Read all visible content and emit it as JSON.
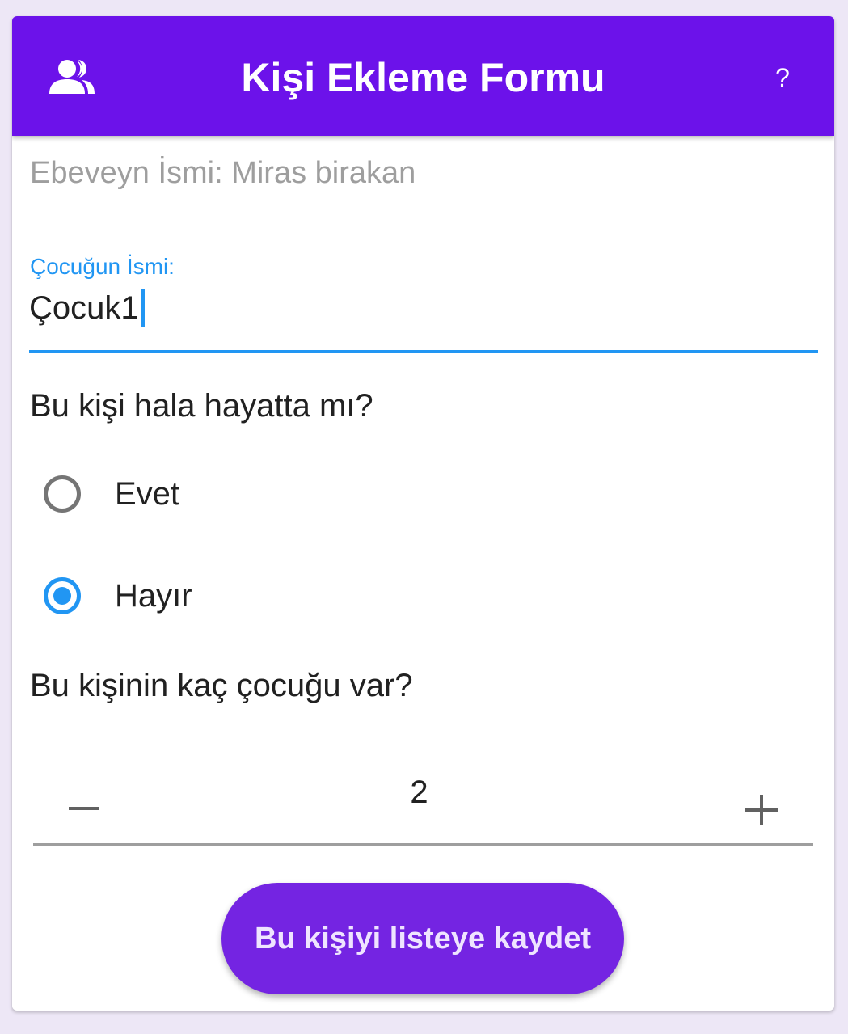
{
  "appbar": {
    "title": "Kişi Ekleme Formu",
    "left_icon": "people-icon",
    "help_label": "?",
    "color": "#6c12ea"
  },
  "form": {
    "parent_name": "Ebeveyn İsmi: Miras birakan",
    "child_name_label": "Çocuğun İsmi:",
    "child_name_value": "Çocuk1",
    "alive_question": "Bu kişi hala hayatta mı?",
    "alive_options": [
      {
        "label": "Evet",
        "selected": false
      },
      {
        "label": "Hayır",
        "selected": true
      }
    ],
    "children_question": "Bu kişinin kaç çocuğu var?",
    "children_count": "2",
    "save_label": "Bu kişiyi listeye kaydet"
  },
  "colors": {
    "accent": "#2196f3",
    "button": "#7424e2",
    "background": "#ede7f6"
  }
}
